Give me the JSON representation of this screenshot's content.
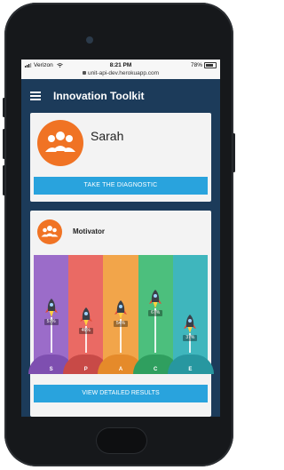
{
  "status": {
    "carrier": "Verizon",
    "time": "8:21 PM",
    "battery": "78%",
    "url": "unit-api-dev.herokuapp.com"
  },
  "app": {
    "title": "Innovation Toolkit"
  },
  "profile": {
    "name": "Sarah",
    "diagnostic_button": "TAKE THE DIAGNOSTIC"
  },
  "motivator": {
    "title": "Motivator",
    "results_button": "VIEW DETAILED RESULTS",
    "columns": [
      {
        "letter": "S",
        "percent": "57%",
        "value": 57,
        "color": "#9b6cc9",
        "mound": "#7e4fb0"
      },
      {
        "letter": "P",
        "percent": "46%",
        "value": 46,
        "color": "#ea6a64",
        "mound": "#c84a47"
      },
      {
        "letter": "A",
        "percent": "54%",
        "value": 54,
        "color": "#f2a54a",
        "mound": "#e58a2a"
      },
      {
        "letter": "C",
        "percent": "67%",
        "value": 67,
        "color": "#4cbf7d",
        "mound": "#2f9f5f"
      },
      {
        "letter": "E",
        "percent": "37%",
        "value": 37,
        "color": "#3fb6bd",
        "mound": "#2797a0"
      }
    ]
  },
  "colors": {
    "accent_orange": "#f07324",
    "button_blue": "#29a3dd",
    "appbar_navy": "#1c3b5a"
  }
}
